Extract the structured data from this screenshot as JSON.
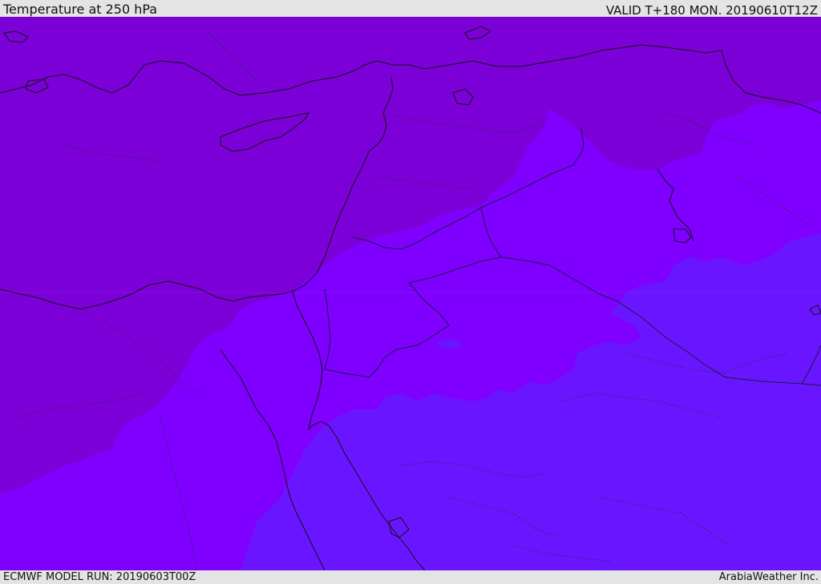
{
  "header": {
    "title": "Temperature at 250 hPa",
    "valid_time": "VALID T+180 MON. 20190610T12Z"
  },
  "footer": {
    "model_run": "ECMWF MODEL RUN: 20190603T00Z",
    "credit": "ArabiaWeather Inc."
  },
  "map": {
    "colors": {
      "warmest_band": "#7c00d8",
      "mid_band": "#7f00ff",
      "cool_band": "#6a15ff",
      "coastline": "#111111",
      "border": "#1a1a3a"
    }
  }
}
